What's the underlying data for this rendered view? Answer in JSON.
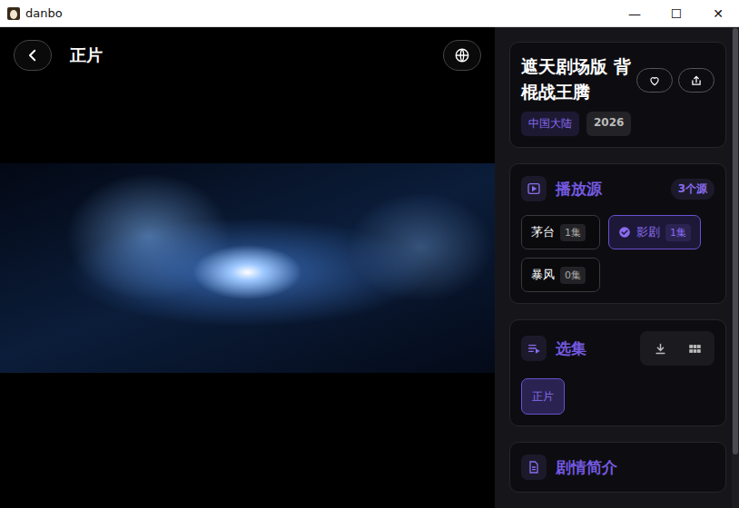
{
  "window": {
    "title": "danbo",
    "controls": [
      "—",
      "☐",
      "✕"
    ]
  },
  "player": {
    "title": "正片"
  },
  "detail": {
    "title": "遮天剧场版 背棍战王腾",
    "favorited": false,
    "tags": [
      {
        "label": "中国大陆",
        "kind": "region"
      },
      {
        "label": "2026",
        "kind": "year"
      }
    ]
  },
  "sources": {
    "heading": "播放源",
    "count": "3个源",
    "items": [
      {
        "name": "茅台",
        "episodes": "1集",
        "selected": false
      },
      {
        "name": "影剧",
        "episodes": "1集",
        "selected": true
      },
      {
        "name": "暴风",
        "episodes": "0集",
        "selected": false
      }
    ]
  },
  "episodes": {
    "heading": "选集",
    "items": [
      {
        "label": "正片",
        "selected": true
      }
    ]
  },
  "synopsis": {
    "heading": "剧情简介"
  }
}
